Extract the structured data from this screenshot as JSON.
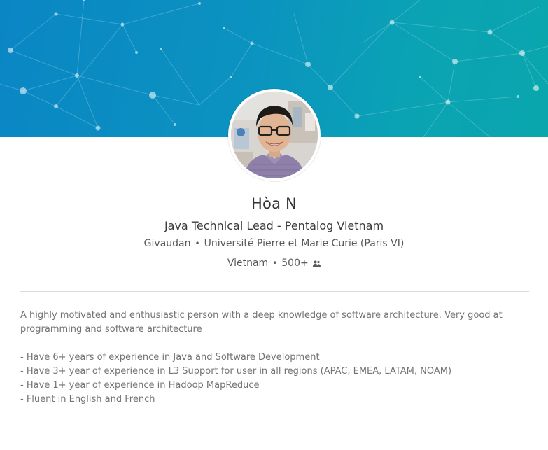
{
  "profile": {
    "name": "Hòa N",
    "headline": "Java Technical Lead - Pentalog Vietnam",
    "company": "Givaudan",
    "school": "Université Pierre et Marie Curie (Paris VI)",
    "location": "Vietnam",
    "connections": "500+",
    "separator": "•"
  },
  "summary": {
    "intro": "A highly motivated and enthusiastic person with a deep knowledge of software architecture. Very good at programming and software architecture",
    "bullets": [
      "- Have 6+ years of experience in Java and Software Development",
      "- Have 3+ year of experience in L3 Support for user in all regions (APAC, EMEA, LATAM, NOAM)",
      "- Have 1+ year of experience in Hadoop MapReduce",
      "- Fluent in English and French"
    ]
  },
  "icons": {
    "connections": "people-icon",
    "avatar": "profile-photo"
  },
  "colors": {
    "banner_start": "#0a86c4",
    "banner_end": "#0aa6ad"
  }
}
